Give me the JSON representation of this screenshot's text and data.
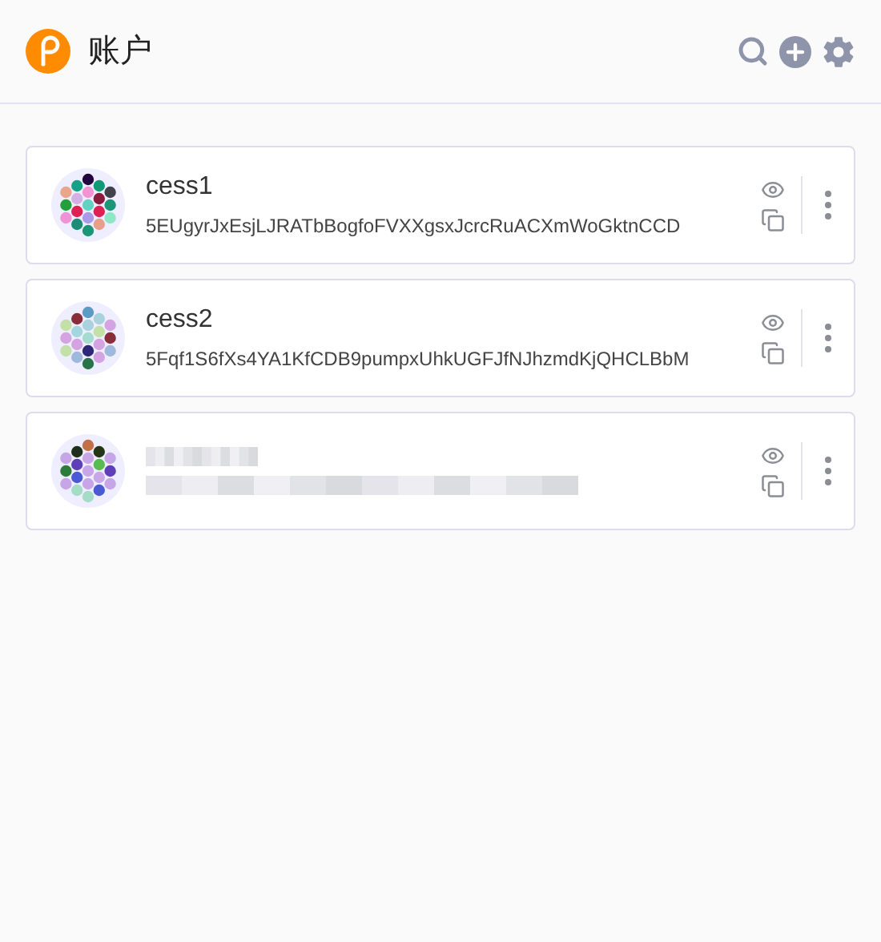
{
  "header": {
    "title": "账户"
  },
  "accounts": [
    {
      "name": "cess1",
      "address": "5EUgyrJxEsjLJRATbBogfoFVXXgsxJcrcRuACXmWoGktnCCD",
      "redacted": false,
      "identicon": [
        {
          "color": "#e9a68c"
        },
        {
          "color": "#22a03a"
        },
        {
          "color": "#ee93d6"
        },
        {
          "color": "#16a085"
        },
        {
          "color": "#d4b0e4"
        },
        {
          "color": "#dd2253"
        },
        {
          "color": "#1c8c77"
        },
        {
          "color": "#22033f"
        },
        {
          "color": "#f293d4"
        },
        {
          "color": "#64d2c0"
        },
        {
          "color": "#ab9ae9"
        },
        {
          "color": "#1b9777"
        },
        {
          "color": "#119a77"
        },
        {
          "color": "#8a1b3c"
        },
        {
          "color": "#dd2253"
        },
        {
          "color": "#e69f8a"
        },
        {
          "color": "#40434a"
        },
        {
          "color": "#1b9777"
        },
        {
          "color": "#8ee7c6"
        }
      ]
    },
    {
      "name": "cess2",
      "address": "5Fqf1S6fXs4YA1KfCDB9pumpxUhkUGFJfNJhzmdKjQHCLBbM",
      "redacted": false,
      "identicon": [
        {
          "color": "#c3e0a6"
        },
        {
          "color": "#d3a3e2"
        },
        {
          "color": "#c3e0a6"
        },
        {
          "color": "#8a2d3a"
        },
        {
          "color": "#a1d7dd"
        },
        {
          "color": "#d3a3e2"
        },
        {
          "color": "#9fb9dc"
        },
        {
          "color": "#5b9bc5"
        },
        {
          "color": "#aad2dc"
        },
        {
          "color": "#a4dccf"
        },
        {
          "color": "#2e2876"
        },
        {
          "color": "#287347"
        },
        {
          "color": "#aad2dc"
        },
        {
          "color": "#c3e0a6"
        },
        {
          "color": "#d3a3e2"
        },
        {
          "color": "#d3a3e2"
        },
        {
          "color": "#d3a3e2"
        },
        {
          "color": "#8a2d3a"
        },
        {
          "color": "#9fb9dc"
        }
      ]
    },
    {
      "redacted": true,
      "identicon": [
        {
          "color": "#c6a6e6"
        },
        {
          "color": "#2e7c3c"
        },
        {
          "color": "#c6a6e6"
        },
        {
          "color": "#1e2f1b"
        },
        {
          "color": "#5e3fb8"
        },
        {
          "color": "#4a5ad4"
        },
        {
          "color": "#a4dcc8"
        },
        {
          "color": "#c17048"
        },
        {
          "color": "#c9a6e6"
        },
        {
          "color": "#c9a6e6"
        },
        {
          "color": "#c6a6e6"
        },
        {
          "color": "#a4dcc8"
        },
        {
          "color": "#243616"
        },
        {
          "color": "#58bd4e"
        },
        {
          "color": "#c9a6e6"
        },
        {
          "color": "#4a5ad4"
        },
        {
          "color": "#c6a6e6"
        },
        {
          "color": "#5e3fb8"
        },
        {
          "color": "#c6a6e6"
        }
      ]
    }
  ]
}
